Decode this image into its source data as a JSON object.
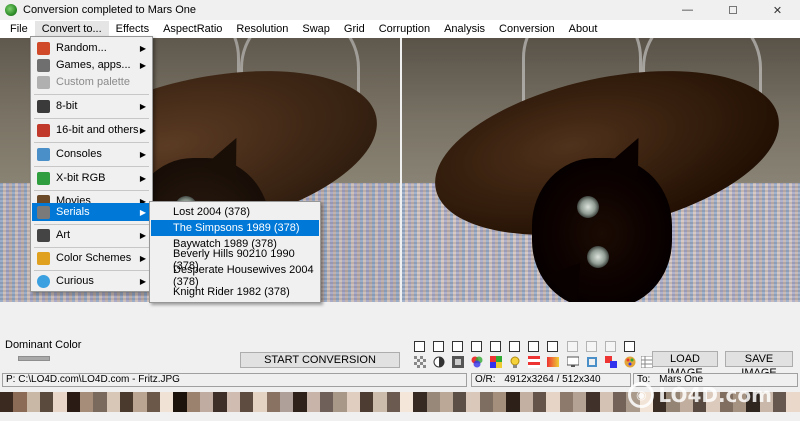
{
  "window": {
    "title": "Conversion completed to Mars One",
    "minimize": "—",
    "close": "✕"
  },
  "menubar": {
    "items": [
      "File",
      "Convert to...",
      "Effects",
      "AspectRatio",
      "Resolution",
      "Swap",
      "Grid",
      "Corruption",
      "Analysis",
      "Conversion",
      "About"
    ]
  },
  "dropdown": {
    "items": [
      {
        "label": "Random...",
        "arrow": "▶",
        "icon_color": "#d04a2a"
      },
      {
        "label": "Games, apps...",
        "arrow": "▶",
        "icon_color": "#6f6f6f"
      },
      {
        "label": "Custom palette",
        "arrow": "",
        "icon_color": "#b0b0b0"
      },
      {
        "label": "8-bit",
        "arrow": "▶",
        "icon_color": "#3a3a3a"
      },
      {
        "label": "16-bit and others",
        "arrow": "▶",
        "icon_color": "#c0392b"
      },
      {
        "label": "Consoles",
        "arrow": "▶",
        "icon_color": "#4a8fc7"
      },
      {
        "label": "X-bit RGB",
        "arrow": "▶",
        "icon_color": "#2e9e3e"
      },
      {
        "label": "Movies",
        "arrow": "▶",
        "icon_color": "#6b4a2a"
      },
      {
        "label": "Serials",
        "arrow": "▶",
        "icon_color": "#7a7a7a"
      },
      {
        "label": "Art",
        "arrow": "▶",
        "icon_color": "#444444"
      },
      {
        "label": "Color Schemes",
        "arrow": "▶",
        "icon_color": "#e0a020"
      },
      {
        "label": "Curious",
        "arrow": "▶",
        "icon_color": "#3aa0e0"
      }
    ]
  },
  "submenu": {
    "items": [
      "Lost 2004 (378)",
      "The Simpsons 1989 (378)",
      "Baywatch 1989 (378)",
      "Beverly Hills 90210 1990 (378)",
      "Desperate Housewives 2004 (378)",
      "Knight Rider 1982 (378)"
    ],
    "selected": "The Simpsons 1989 (378)"
  },
  "controls": {
    "dominant_label": "Dominant Color",
    "start_label": "START CONVERSION",
    "load_label": "LOAD IMAGE",
    "save_label": "SAVE IMAGE"
  },
  "status": {
    "path": "P:  C:\\LO4D.com\\LO4D.com - Fritz.JPG",
    "or_label": "O/R:",
    "or_value": "4912x3264 / 512x340",
    "to_label": "To:",
    "to_value": "Mars One"
  },
  "watermark": {
    "text": "LO4D.com"
  },
  "colors": {
    "highlight": "#0078d7",
    "menu_bg": "#ffffff",
    "window_bg": "#f0f0f0"
  },
  "palette": [
    "#3b2a20",
    "#8b6b55",
    "#c9b8a6",
    "#5a4a3e",
    "#e8d6c8",
    "#2a1c14",
    "#a58d7a",
    "#7a6a5e",
    "#d8c6b6",
    "#4a3a2e",
    "#b9a592",
    "#6b5848",
    "#f0e2d4",
    "#1c130d",
    "#9a826e",
    "#c0aca0",
    "#3e3028",
    "#d0bcb0",
    "#5e4c40",
    "#e4d2c2",
    "#8a7262",
    "#b0a09a",
    "#2e221a",
    "#c8b4a8",
    "#70605a",
    "#a89888",
    "#e0cec0",
    "#4c3c32",
    "#ccbcac",
    "#6a5a50",
    "#f4e6d8",
    "#362a22",
    "#98887a",
    "#bca896",
    "#5c5046",
    "#dac8ba",
    "#7e6e62",
    "#a48e7c",
    "#2c2018",
    "#c4b0a2",
    "#64544a",
    "#e6d4c6",
    "#8e7a6c",
    "#b4a294",
    "#40322a",
    "#d4c2b4",
    "#726258",
    "#aa9a8c",
    "#f2e4d6",
    "#3a2e24",
    "#948474",
    "#c2ae9e",
    "#584a40",
    "#dccabc",
    "#806e60",
    "#a69280",
    "#302620",
    "#cab8aa",
    "#66584e",
    "#ead8ca"
  ]
}
